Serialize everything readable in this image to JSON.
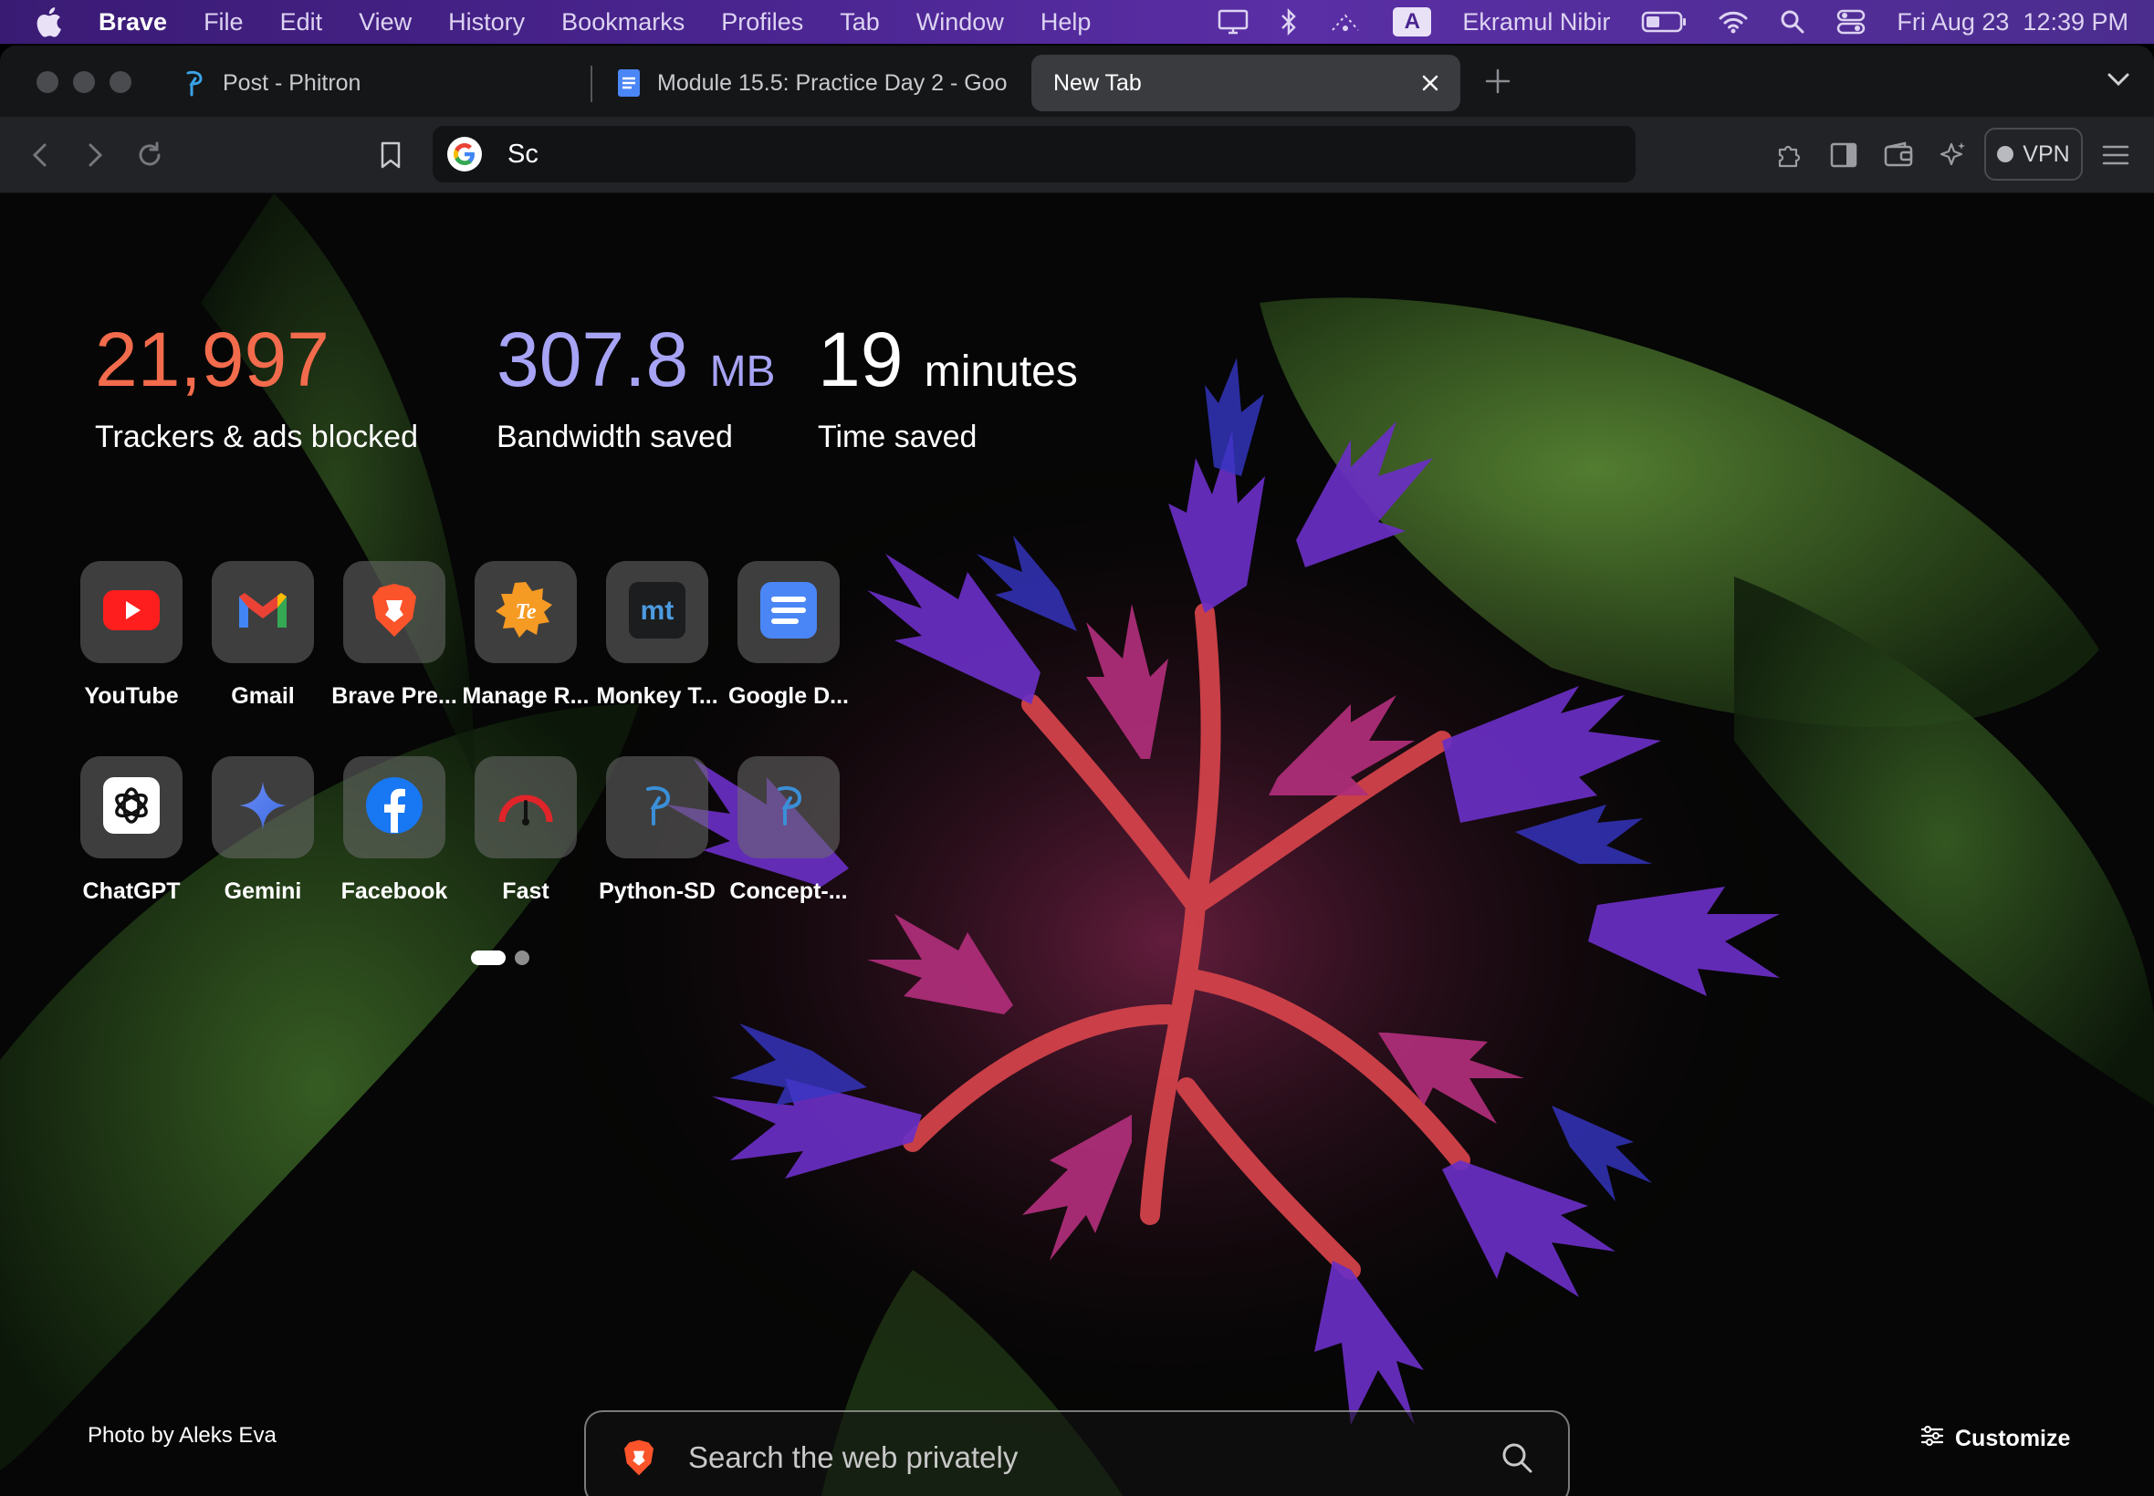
{
  "menubar": {
    "app": "Brave",
    "items": [
      "File",
      "Edit",
      "View",
      "History",
      "Bookmarks",
      "Profiles",
      "Tab",
      "Window",
      "Help"
    ],
    "input_source": "A",
    "user": "Ekramul Nibir",
    "datetime": "Fri Aug 23  12:39 PM"
  },
  "tabs": [
    {
      "title": "Post - Phitron",
      "icon": "phitron-icon"
    },
    {
      "title": "Module 15.5: Practice Day 2 - Goo",
      "icon": "google-docs-icon"
    },
    {
      "title": "New Tab",
      "icon": "none"
    }
  ],
  "omnibox": {
    "value": "Sc"
  },
  "toolbar": {
    "vpn_label": "VPN"
  },
  "stats": {
    "trackers": {
      "value": "21,997",
      "label": "Trackers & ads blocked",
      "color": "#f26b4c"
    },
    "bandwidth": {
      "value": "307.8",
      "unit": "MB",
      "label": "Bandwidth saved",
      "color": "#a7a3f5"
    },
    "time": {
      "value": "19",
      "unit": "minutes",
      "label": "Time saved",
      "color": "#ffffff"
    }
  },
  "top_sites": [
    {
      "label": "YouTube",
      "icon": "youtube-icon"
    },
    {
      "label": "Gmail",
      "icon": "gmail-icon"
    },
    {
      "label": "Brave Pre...",
      "icon": "brave-icon"
    },
    {
      "label": "Manage R...",
      "icon": "te-icon"
    },
    {
      "label": "Monkey T...",
      "icon": "monkeytype-icon"
    },
    {
      "label": "Google D...",
      "icon": "google-docs-icon"
    },
    {
      "label": "ChatGPT",
      "icon": "chatgpt-icon"
    },
    {
      "label": "Gemini",
      "icon": "gemini-icon"
    },
    {
      "label": "Facebook",
      "icon": "facebook-icon"
    },
    {
      "label": "Fast",
      "icon": "fast-icon"
    },
    {
      "label": "Python-SD",
      "icon": "phitron-icon"
    },
    {
      "label": "Concept-...",
      "icon": "phitron-icon"
    }
  ],
  "pager": {
    "pages": 2,
    "current": 1
  },
  "footer": {
    "credit": "Photo by Aleks Eva",
    "search_placeholder": "Search the web privately",
    "customize_label": "Customize"
  }
}
